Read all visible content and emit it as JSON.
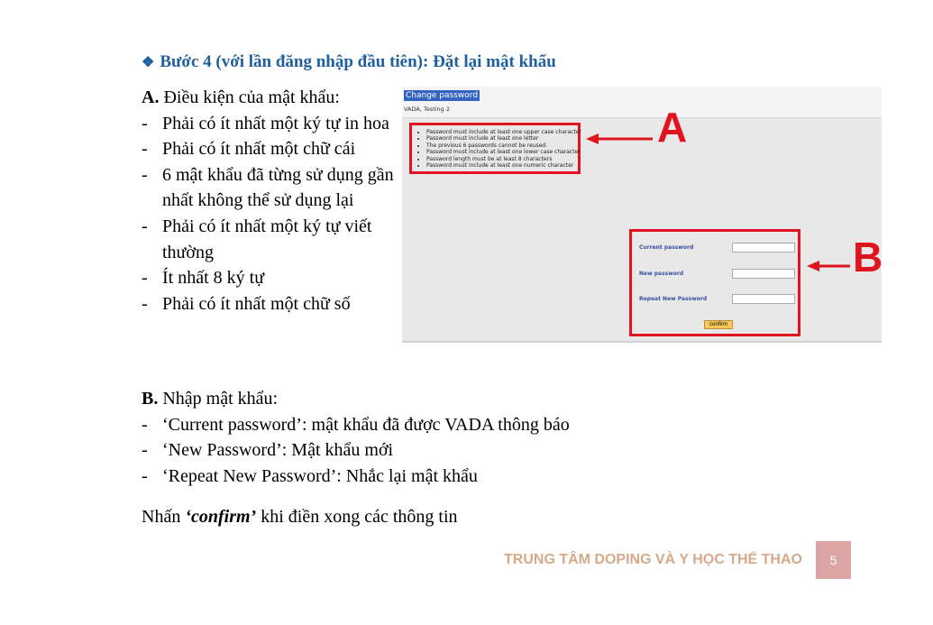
{
  "heading": "Bước 4 (với lần đăng nhập đầu tiên): Đặt lại mật khẩu",
  "sectionA": {
    "letter": "A.",
    "title": "Điều kiện của mật khẩu:",
    "items": [
      "Phải có ít nhất một ký tự in hoa",
      "Phải có ít nhất một chữ cái",
      "6 mật khẩu đã từng sử dụng gần nhất không thể sử dụng lại",
      "Phải có ít nhất một ký tự viết thường",
      "Ít nhất 8 ký tự",
      "Phải có ít nhất một chữ số"
    ]
  },
  "sectionB": {
    "letter": "B.",
    "title": "Nhập mật khẩu:",
    "items": [
      "‘Current password’: mật khẩu đã được VADA thông báo",
      "‘New Password’: Mật khẩu mới",
      "‘Repeat New Password’: Nhắc lại mật khẩu"
    ]
  },
  "confirm_line": {
    "prefix": "Nhấn ",
    "emphasis": "‘confirm’",
    "suffix": " khi điền xong các thông tin"
  },
  "screenshot": {
    "title": "Change password",
    "user": "VADA, Testing 2",
    "requirements": [
      "Password must include at least one upper case character",
      "Password must include at least one letter",
      "The previous 6 passwords cannot be reused.",
      "Password must include at least one lower case character",
      "Password length must be at least 8 characters",
      "Password must include at least one numeric character"
    ],
    "fields": [
      {
        "label": "Current password",
        "value": ""
      },
      {
        "label": "New password",
        "value": ""
      },
      {
        "label": "Repeat New Password",
        "value": ""
      }
    ],
    "confirm_button": "confirm",
    "callout_a": "A",
    "callout_b": "B",
    "callout_color": "#e0141e"
  },
  "footer": {
    "org": "TRUNG TÂM DOPING VÀ Y HỌC THỂ THAO",
    "page": "5"
  }
}
